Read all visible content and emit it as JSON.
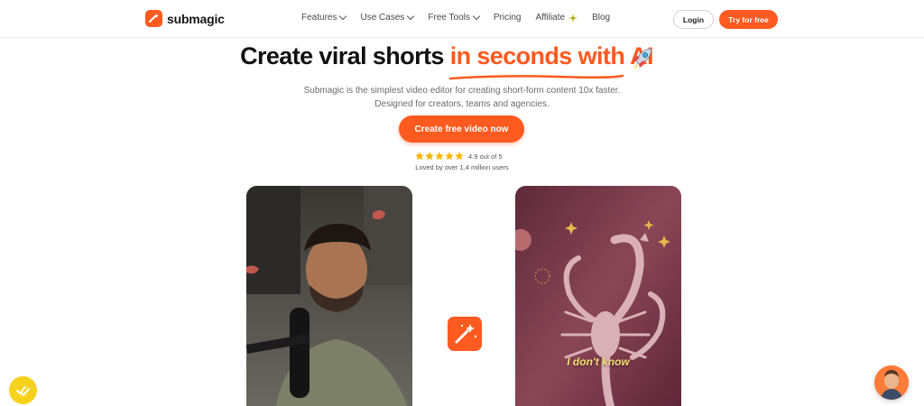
{
  "brand": {
    "name": "submagic",
    "color": "#ff5a1f"
  },
  "nav": {
    "items": [
      {
        "label": "Features",
        "dropdown": true
      },
      {
        "label": "Use Cases",
        "dropdown": true
      },
      {
        "label": "Free Tools",
        "dropdown": true
      },
      {
        "label": "Pricing",
        "dropdown": false
      },
      {
        "label": "Affiliate",
        "dropdown": false,
        "icon": "sparkle-icon"
      },
      {
        "label": "Blog",
        "dropdown": false
      }
    ],
    "login": "Login",
    "try": "Try for free"
  },
  "hero": {
    "headline_start": "Create viral shorts ",
    "headline_accent": "in seconds with AI",
    "subtitle_line1": "Submagic is the simplest video editor for creating short-form content 10x faster.",
    "subtitle_line2": "Designed for creators, teams and agencies.",
    "cta": "Create free video now",
    "rating_text": "4.9 out of 5",
    "rating_value": 4.9,
    "loved": "Loved by over 1.4 million users"
  },
  "video": {
    "caption": "I don't know"
  }
}
